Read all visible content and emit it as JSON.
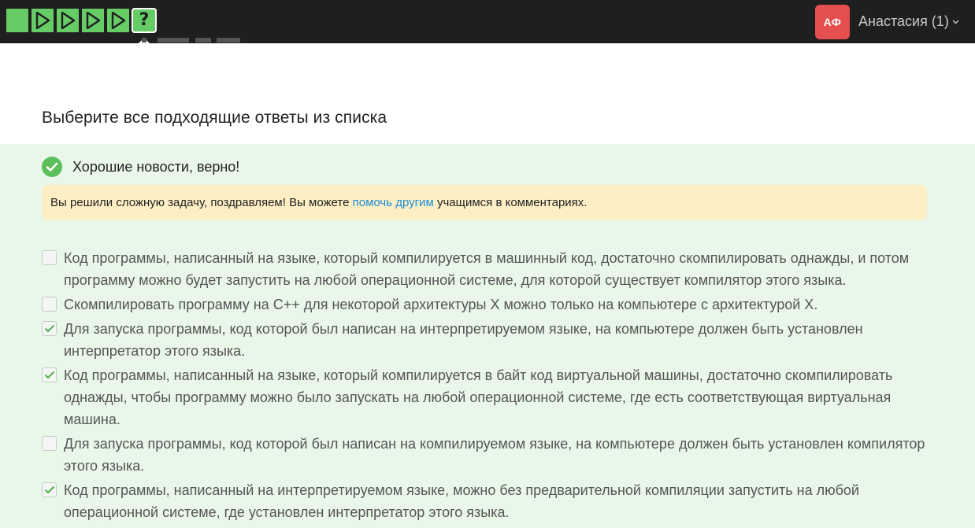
{
  "topbar": {
    "steps": [
      {
        "state": "solved",
        "icon": "green-square"
      },
      {
        "state": "solved",
        "icon": "play-icon"
      },
      {
        "state": "solved",
        "icon": "play-icon"
      },
      {
        "state": "solved",
        "icon": "play-icon"
      },
      {
        "state": "solved",
        "icon": "play-icon"
      },
      {
        "state": "current",
        "icon": "question-icon",
        "label": "?"
      }
    ],
    "avatar_initials": "АФ",
    "user_label": "Анастасия (1)",
    "colors": {
      "bar": "#1f1f1f",
      "step": "#66cc66",
      "avatar": "#e64f4f"
    }
  },
  "question": {
    "title": "Выберите все подходящие ответы из списка"
  },
  "feedback": {
    "status_text": "Хорошие новости, верно!",
    "notice_before": "Вы решили сложную задачу, поздравляем! Вы можете ",
    "notice_link": "помочь другим",
    "notice_after": " учащимся в комментариях."
  },
  "options": [
    {
      "text": "Код программы, написанный на языке, который компилируется в машинный код, достаточно скомпилировать однажды, и потом программу можно будет запустить на любой операционной системе, для которой существует компилятор этого языка.",
      "checked": false
    },
    {
      "text": "Скомпилировать программу на C++ для некоторой архитектуры X можно только на компьютере с архитектурой X.",
      "checked": false
    },
    {
      "text": "Для запуска программы, код которой был написан на интерпретируемом языке, на компьютере должен быть установлен интерпретатор этого языка.",
      "checked": true
    },
    {
      "text": "Код программы, написанный на языке, который компилируется в байт код виртуальной машины, достаточно скомпилировать однажды, чтобы программу можно было запускать на любой операционной системе, где есть соответствующая виртуальная машина.",
      "checked": true
    },
    {
      "text": "Для запуска программы, код которой был написан на компилируемом языке, на компьютере должен быть установлен компилятор этого языка.",
      "checked": false
    },
    {
      "text": "Код программы, написанный на интерпретируемом языке, можно без предварительной компиляции запустить на любой операционной системе, где установлен интерпретатор этого языка.",
      "checked": true
    }
  ]
}
